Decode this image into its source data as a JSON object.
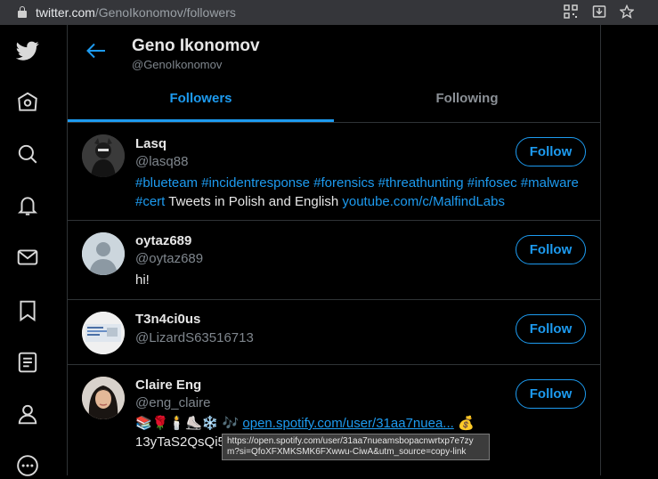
{
  "browser": {
    "url_host": "twitter.com",
    "url_path": "/GenoIkonomov/followers"
  },
  "profile": {
    "name": "Geno Ikonomov",
    "handle": "@GenoIkonomov"
  },
  "tabs": [
    {
      "label": "Followers",
      "active": true
    },
    {
      "label": "Following",
      "active": false
    }
  ],
  "followers": [
    {
      "name": "Lasq",
      "handle": "@lasq88",
      "bio_tags": "#blueteam #incidentresponse #forensics #threathunting #infosec #malware",
      "bio_tag2": "#cert",
      "bio_text": " Tweets in Polish and English ",
      "bio_link": "youtube.com/c/MalfindLabs",
      "button": "Follow"
    },
    {
      "name": "oytaz689",
      "handle": "@oytaz689",
      "bio_text": "hi!",
      "button": "Follow"
    },
    {
      "name": "T3n4ci0us",
      "handle": "@LizardS63516713",
      "button": "Follow"
    },
    {
      "name": "Claire Eng",
      "handle": "@eng_claire",
      "bio_emoji": "📚🌹🕯️⛸️❄️ 🎶 ",
      "bio_link": "open.spotify.com/user/31aa7nuea...",
      "bio_emoji_end": " 💰",
      "bio_line2": "13yTaS2QsQi5C",
      "button": "Follow"
    }
  ],
  "tooltip": "https://open.spotify.com/user/31aa7nueamsbopacnwrtxp7e7zym?si=QfoXFXMKSMK6FXwwu-CiwA&utm_source=copy-link",
  "colors": {
    "accent": "#1d9bf0",
    "background": "#000000",
    "border": "#2f3336"
  }
}
